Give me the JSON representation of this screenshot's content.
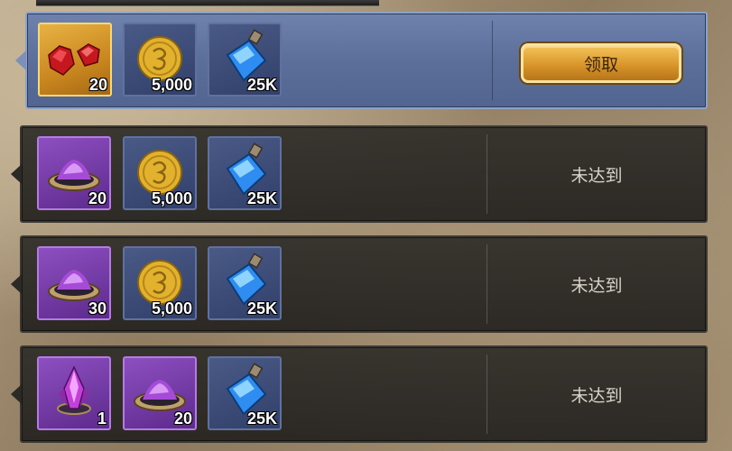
{
  "claim_label": "领取",
  "not_reached_label": "未达到",
  "rows": [
    {
      "state": "claimable",
      "rewards": [
        {
          "icon": "ruby-icon",
          "frame": "gold",
          "count": "20"
        },
        {
          "icon": "gold-coin-icon",
          "frame": "blue",
          "count": "5,000"
        },
        {
          "icon": "blue-potion-icon",
          "frame": "blue",
          "count": "25K"
        }
      ]
    },
    {
      "state": "locked",
      "rewards": [
        {
          "icon": "purple-dust-icon",
          "frame": "purple",
          "count": "20"
        },
        {
          "icon": "gold-coin-icon",
          "frame": "blue",
          "count": "5,000"
        },
        {
          "icon": "blue-potion-icon",
          "frame": "blue",
          "count": "25K"
        }
      ]
    },
    {
      "state": "locked",
      "rewards": [
        {
          "icon": "purple-dust-icon",
          "frame": "purple",
          "count": "30"
        },
        {
          "icon": "gold-coin-icon",
          "frame": "blue",
          "count": "5,000"
        },
        {
          "icon": "blue-potion-icon",
          "frame": "blue",
          "count": "25K"
        }
      ]
    },
    {
      "state": "locked",
      "rewards": [
        {
          "icon": "purple-crystal-icon",
          "frame": "purple",
          "count": "1"
        },
        {
          "icon": "purple-dust-icon",
          "frame": "purple",
          "count": "20"
        },
        {
          "icon": "blue-potion-icon",
          "frame": "blue",
          "count": "25K"
        }
      ]
    }
  ],
  "colors": {
    "active_row": "#5b6f9a",
    "locked_row": "#302e2a",
    "button": "#d9962b"
  }
}
